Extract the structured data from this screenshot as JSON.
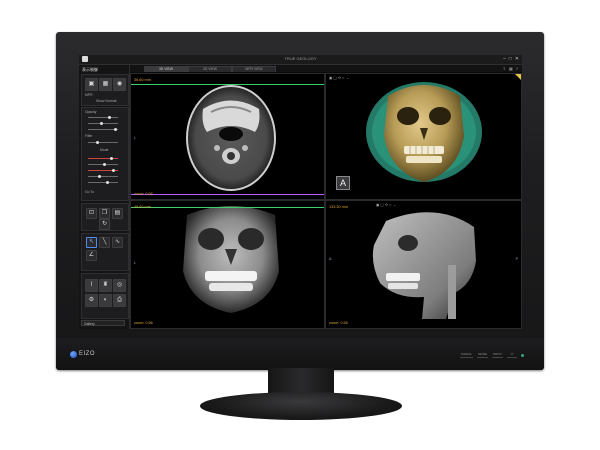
{
  "window": {
    "title": "TRUE GEOLOGY"
  },
  "window_controls": [
    "–",
    "□",
    "✕"
  ],
  "sidebar": {
    "tool_title": "表示制御",
    "labels": {
      "view": "MPR",
      "preset": "Show Normal",
      "opacity": "Opacity",
      "filter": "Filter",
      "display": "Mode",
      "scroll": "Go To"
    },
    "gallery": "Gallery"
  },
  "tabs": [
    {
      "label": "3D VIEW",
      "active": true
    },
    {
      "label": "2D VIEW",
      "active": false
    },
    {
      "label": "MPR VIEW",
      "active": false
    }
  ],
  "viewports": {
    "axial": {
      "mm": "36.60 mm",
      "zoom": "zoom: 0.56"
    },
    "render3d": {
      "badge": "A"
    },
    "coronal": {
      "mm": "49.60 mm",
      "zoom": "zoom: 0.56"
    },
    "sagittal": {
      "mm": "133.30 mm",
      "zoom": "zoom: 0.56"
    }
  },
  "markers": {
    "left": "L",
    "anterior": "A",
    "posterior": "P"
  },
  "brand": {
    "name": "EIZO"
  },
  "hardware_buttons": [
    "SIGNAL",
    "MODE",
    "INPUT",
    "⏻"
  ],
  "colors": {
    "measurement": "#e1a23a",
    "axial_line": "#3fd06a",
    "coronal_line": "#b35cff",
    "volume_tint": "#2fa38a"
  }
}
